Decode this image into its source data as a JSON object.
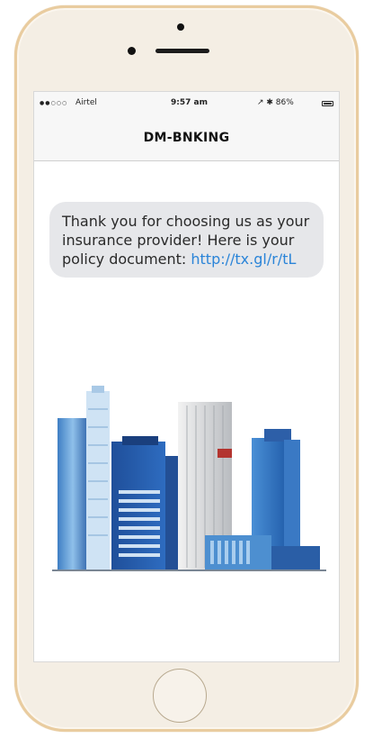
{
  "status_bar": {
    "signal": "●●○○○",
    "carrier": "Airtel",
    "time": "9:57 am",
    "right": "↗ ✱ 86%"
  },
  "nav": {
    "title": "DM-BNKING"
  },
  "message": {
    "text": "Thank you for choosing us as your insurance provider! Here is your policy document: ",
    "link": "http://tx.gl/r/tL"
  },
  "colors": {
    "phone_frame": "#e9cc9f",
    "bubble": "#e6e7ea",
    "link": "#2a84d8"
  }
}
